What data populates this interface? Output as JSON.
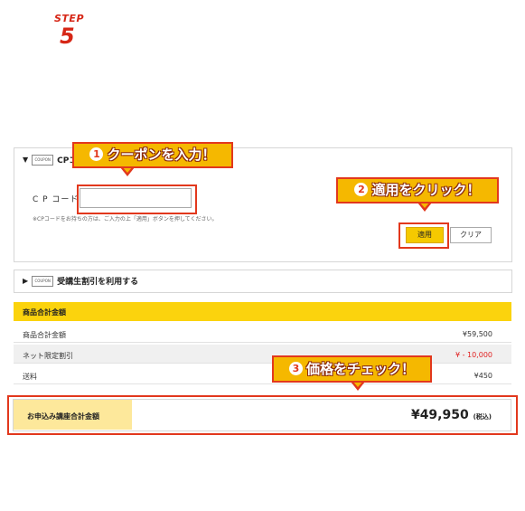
{
  "step": {
    "label": "STEP",
    "number": "5"
  },
  "coupon_section": {
    "title": "CPコード",
    "coupon_tag": "COUPON",
    "field_label": "C P コード",
    "input_value": "",
    "note": "※CPコードをお持ちの方は、ご入力の上「適用」ボタンを押してください。",
    "apply_button": "適用",
    "clear_button": "クリア"
  },
  "student_section": {
    "coupon_tag": "COUPON",
    "title": "受講生割引を利用する"
  },
  "totals": {
    "header": "商品合計金額",
    "rows": [
      {
        "label": "商品合計金額",
        "value": "¥59,500"
      },
      {
        "label": "ネット限定割引",
        "value": "¥ - 10,000"
      },
      {
        "label": "送料",
        "value": "¥450"
      }
    ],
    "grand_total_label": "お申込み講座合計金額",
    "grand_total_value": "¥49,950",
    "tax_note": "(税込)"
  },
  "callouts": [
    {
      "num": "1",
      "text": "クーポンを入力！"
    },
    {
      "num": "2",
      "text": "適用をクリック！"
    },
    {
      "num": "3",
      "text": "価格をチェック！"
    }
  ],
  "colors": {
    "accent_red": "#e2381d",
    "yellow": "#fbd30d",
    "light_yellow": "#fde89b",
    "discount_red": "#e02020"
  }
}
